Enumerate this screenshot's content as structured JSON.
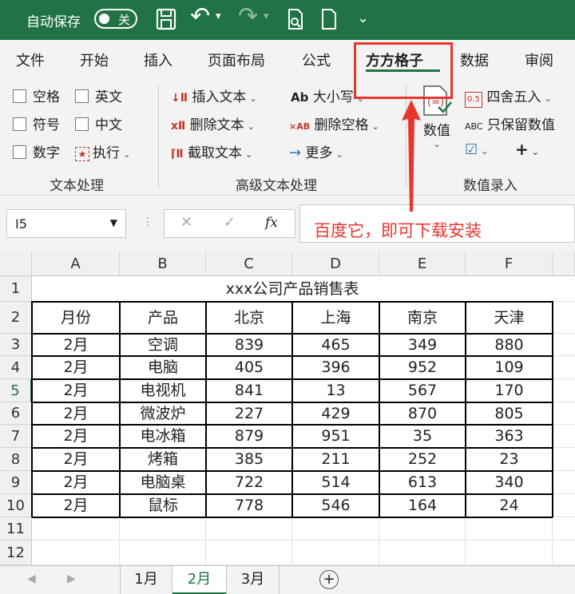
{
  "titlebar": {
    "autosave_label": "自动保存",
    "autosave_state": "关",
    "undo_label": "↶",
    "redo_label": "↷",
    "more_label": "⌄"
  },
  "tabs": [
    "文件",
    "开始",
    "插入",
    "页面布局",
    "公式",
    "方方格子",
    "数据",
    "审阅"
  ],
  "active_tab": "方方格子",
  "ribbon": {
    "text_group": {
      "items": [
        "空格",
        "英文",
        "符号",
        "中文",
        "数字",
        "执行"
      ],
      "label": "文本处理"
    },
    "advanced_group": {
      "insert_text": "插入文本",
      "delete_text": "删除文本",
      "extract_text": "截取文本",
      "case": "大小写",
      "delete_spaces": "删除空格",
      "more": "更多",
      "label": "高级文本处理"
    },
    "number_group": {
      "number_value": "数值",
      "round": "四舍五入",
      "keep_values": "只保留数值",
      "label": "数值录入"
    }
  },
  "formula_bar": {
    "name_box": "I5",
    "cancel": "✕",
    "confirm": "✓",
    "fx": "fx"
  },
  "annotation": "百度它，即可下载安装",
  "sheet": {
    "columns": [
      "A",
      "B",
      "C",
      "D",
      "E",
      "F"
    ],
    "rows": [
      "1",
      "2",
      "3",
      "4",
      "5",
      "6",
      "7",
      "8",
      "9",
      "10",
      "11",
      "12"
    ],
    "selected_row": "5",
    "title": "xxx公司产品销售表",
    "headers": [
      "月份",
      "产品",
      "北京",
      "上海",
      "南京",
      "天津"
    ],
    "data": [
      [
        "2月",
        "空调",
        "839",
        "465",
        "349",
        "880"
      ],
      [
        "2月",
        "电脑",
        "405",
        "396",
        "952",
        "109"
      ],
      [
        "2月",
        "电视机",
        "841",
        "13",
        "567",
        "170"
      ],
      [
        "2月",
        "微波炉",
        "227",
        "429",
        "870",
        "805"
      ],
      [
        "2月",
        "电冰箱",
        "879",
        "951",
        "35",
        "363"
      ],
      [
        "2月",
        "烤箱",
        "385",
        "211",
        "252",
        "23"
      ],
      [
        "2月",
        "电脑桌",
        "722",
        "514",
        "613",
        "340"
      ],
      [
        "2月",
        "鼠标",
        "778",
        "546",
        "164",
        "24"
      ]
    ]
  },
  "sheet_tabs": [
    "1月",
    "2月",
    "3月"
  ],
  "active_sheet": "2月",
  "add_sheet": "+",
  "colors": {
    "accent": "#217346",
    "annotation": "#e8362e"
  }
}
